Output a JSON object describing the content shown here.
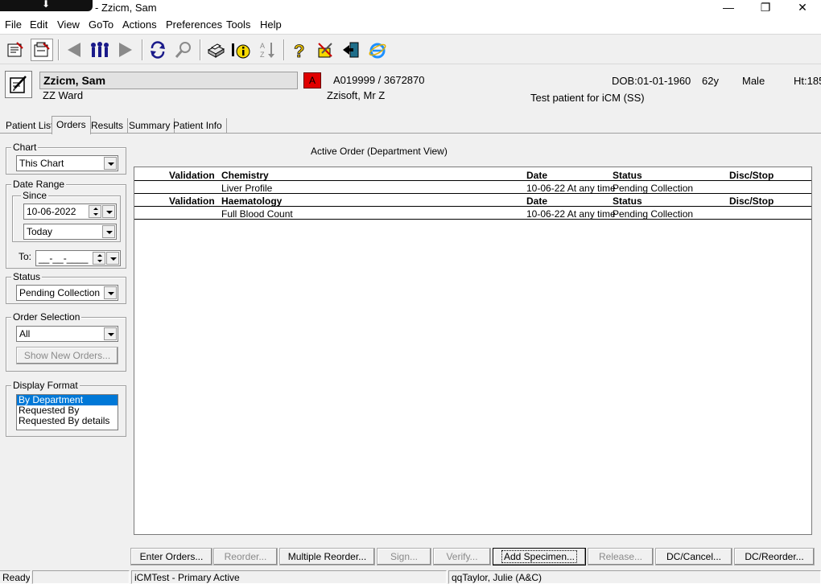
{
  "window": {
    "title": "- Zzicm, Sam"
  },
  "menu": [
    "File",
    "Edit",
    "View",
    "GoTo",
    "Actions",
    "Preferences",
    "Tools",
    "Help"
  ],
  "patient": {
    "name": "Zzicm, Sam",
    "ward": "ZZ Ward",
    "alert": "A",
    "ids": "A019999 / 3672870",
    "consultant": "Zzisoft, Mr Z",
    "dob": "DOB:01-01-1960",
    "age": "62y",
    "sex": "Male",
    "height": "Ht:185",
    "note": "Test patient for iCM (SS)"
  },
  "tabs": [
    "Patient List",
    "Orders",
    "Results",
    "Summary",
    "Patient Info"
  ],
  "filters": {
    "chart_label": "Chart",
    "chart_value": "This Chart",
    "date_range_label": "Date Range",
    "since_label": "Since",
    "since_date": "10-06-2022",
    "since_preset": "Today",
    "to_label": "To:",
    "to_value": "__-__-____",
    "status_label": "Status",
    "status_value": "Pending Collection",
    "order_selection_label": "Order Selection",
    "order_selection_value": "All",
    "show_new_orders": "Show New Orders...",
    "display_format_label": "Display Format",
    "display_format_options": [
      "By Department",
      "Requested By",
      "Requested By details"
    ],
    "display_format_selected": "By Department"
  },
  "orders": {
    "title": "Active Order (Department View)",
    "groups": [
      {
        "header": {
          "validation": "Validation",
          "department": "Chemistry",
          "date": "Date",
          "status": "Status",
          "disc": "Disc/Stop"
        },
        "rows": [
          {
            "name": "Liver Profile",
            "date": "10-06-22 At any time",
            "status": "Pending Collection",
            "disc": ""
          }
        ]
      },
      {
        "header": {
          "validation": "Validation",
          "department": "Haematology",
          "date": "Date",
          "status": "Status",
          "disc": "Disc/Stop"
        },
        "rows": [
          {
            "name": "Full Blood Count",
            "date": "10-06-22 At any time",
            "status": "Pending Collection",
            "disc": ""
          }
        ]
      }
    ]
  },
  "buttons": {
    "enter_orders": "Enter Orders...",
    "reorder": "Reorder...",
    "multiple_reorder": "Multiple Reorder...",
    "sign": "Sign...",
    "verify": "Verify...",
    "add_specimen": "Add Specimen...",
    "release": "Release...",
    "dc_cancel": "DC/Cancel...",
    "dc_reorder": "DC/Reorder..."
  },
  "status": {
    "ready": "Ready",
    "system": "iCMTest - Primary Active",
    "user": "qqTaylor, Julie  (A&C)"
  },
  "icons": [
    "open-chart-icon",
    "print-chart-icon",
    "back-arrow-icon",
    "people-icon",
    "forward-arrow-icon",
    "refresh-icon",
    "search-icon",
    "printer-icon",
    "info-icon",
    "sort-icon",
    "help-icon",
    "tools-icon",
    "exit-icon",
    "internet-explorer-icon",
    "edit-note-icon"
  ],
  "colors": {
    "alert": "#e00000",
    "selection": "#0078d7"
  }
}
